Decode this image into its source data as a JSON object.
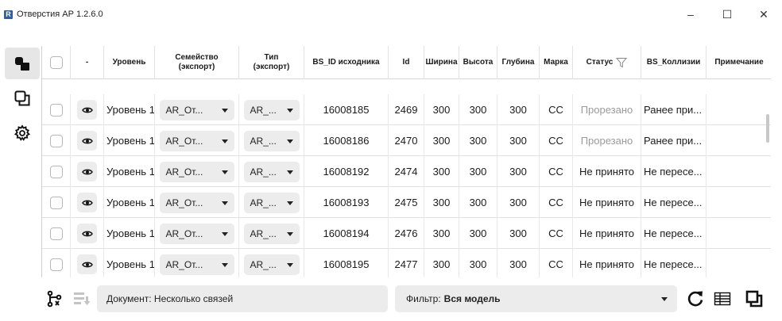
{
  "window": {
    "title": "Отверстия АР 1.2.6.0",
    "logo_letter": "R",
    "controls": {
      "minimize": "–",
      "maximize": "☐",
      "close": "✕"
    }
  },
  "sidebar": {
    "items": [
      {
        "name": "openings-view",
        "icon": "openings-icon",
        "active": true
      },
      {
        "name": "copy-view",
        "icon": "copy-icon",
        "active": false
      },
      {
        "name": "settings-view",
        "icon": "gear-icon",
        "active": false
      }
    ]
  },
  "table": {
    "columns": {
      "select": "",
      "view": "-",
      "level": "Уровень",
      "family": "Семейство (экспорт)",
      "type": "Тип (экспорт)",
      "bs_id": "BS_ID исходника",
      "id": "Id",
      "width": "Ширина",
      "height": "Высота",
      "depth": "Глубина",
      "mark": "Марка",
      "status": "Статус",
      "collisions": "BS_Коллизии",
      "note": "Примечание"
    },
    "rows": [
      {
        "level": "Уровень 1",
        "family": "AR_От...",
        "type": "AR_...",
        "bs_id": "16008185",
        "id": "2469",
        "width": "300",
        "height": "300",
        "depth": "300",
        "mark": "СС",
        "status": "Прорезано",
        "collisions": "Ранее при...",
        "note": "",
        "status_muted": true
      },
      {
        "level": "Уровень 1",
        "family": "AR_От...",
        "type": "AR_...",
        "bs_id": "16008186",
        "id": "2470",
        "width": "300",
        "height": "300",
        "depth": "300",
        "mark": "СС",
        "status": "Прорезано",
        "collisions": "Ранее при...",
        "note": "",
        "status_muted": true
      },
      {
        "level": "Уровень 1",
        "family": "AR_От...",
        "type": "AR_...",
        "bs_id": "16008192",
        "id": "2474",
        "width": "300",
        "height": "300",
        "depth": "300",
        "mark": "СС",
        "status": "Не принято",
        "collisions": "Не пересе...",
        "note": "",
        "status_muted": false
      },
      {
        "level": "Уровень 1",
        "family": "AR_От...",
        "type": "AR_...",
        "bs_id": "16008193",
        "id": "2475",
        "width": "300",
        "height": "300",
        "depth": "300",
        "mark": "СС",
        "status": "Не принято",
        "collisions": "Не пересе...",
        "note": "",
        "status_muted": false
      },
      {
        "level": "Уровень 1",
        "family": "AR_От...",
        "type": "AR_...",
        "bs_id": "16008194",
        "id": "2476",
        "width": "300",
        "height": "300",
        "depth": "300",
        "mark": "СС",
        "status": "Не принято",
        "collisions": "Не пересе...",
        "note": "",
        "status_muted": false
      },
      {
        "level": "Уровень 1",
        "family": "AR_От...",
        "type": "AR_...",
        "bs_id": "16008195",
        "id": "2477",
        "width": "300",
        "height": "300",
        "depth": "300",
        "mark": "СС",
        "status": "Не принято",
        "collisions": "Не пересе...",
        "note": "",
        "status_muted": false
      }
    ]
  },
  "bottom_bar": {
    "document_label": "Документ: Несколько связей",
    "filter_label": "Фильтр:",
    "filter_value": "Вся модель",
    "icons": [
      "hierarchy-icon",
      "export-list-icon",
      "refresh-icon",
      "table-icon",
      "window-icon"
    ]
  },
  "colors": {
    "muted_status": "#9a9a9a",
    "field_bg": "#ececec",
    "active_side": "#e6e6e6"
  }
}
